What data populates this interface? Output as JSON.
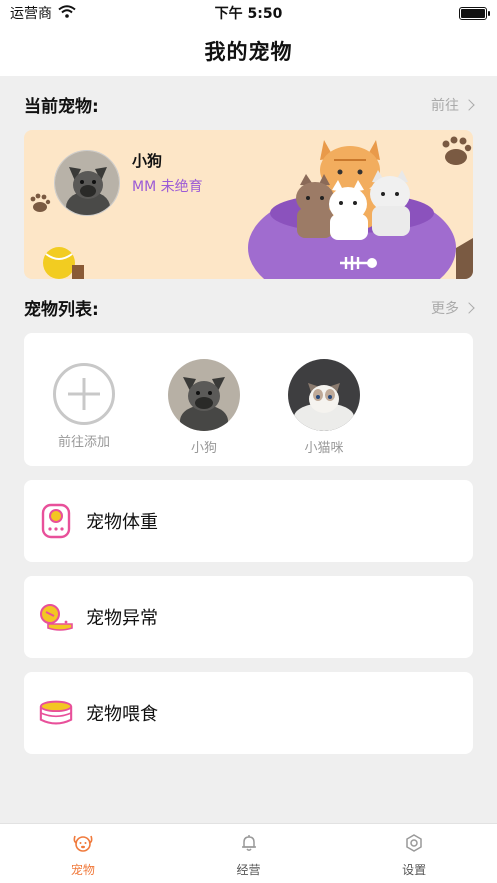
{
  "status_bar": {
    "carrier": "运营商",
    "time": "下午 5:50"
  },
  "nav": {
    "title": "我的宠物"
  },
  "current_pet": {
    "section_title": "当前宠物:",
    "link_label": "前往",
    "name": "小狗",
    "subtitle": "MM 未绝育"
  },
  "pet_list": {
    "section_title": "宠物列表:",
    "link_label": "更多",
    "items": [
      {
        "label": "前往添加"
      },
      {
        "label": "小狗"
      },
      {
        "label": "小猫咪"
      }
    ]
  },
  "features": [
    {
      "label": "宠物体重",
      "icon": "weight-scale-icon"
    },
    {
      "label": "宠物异常",
      "icon": "pet-abnormal-icon"
    },
    {
      "label": "宠物喂食",
      "icon": "food-bowl-icon"
    }
  ],
  "tabs": [
    {
      "label": "宠物",
      "icon": "pet-face-icon",
      "active": true
    },
    {
      "label": "经营",
      "icon": "bell-icon",
      "active": false
    },
    {
      "label": "设置",
      "icon": "settings-icon",
      "active": false
    }
  ],
  "colors": {
    "accent_orange": "#f07a3c",
    "accent_purple": "#9b5ad6",
    "icon_pink": "#e8509a",
    "icon_yellow": "#f3c623",
    "banner_bg": "#fde6c7"
  }
}
